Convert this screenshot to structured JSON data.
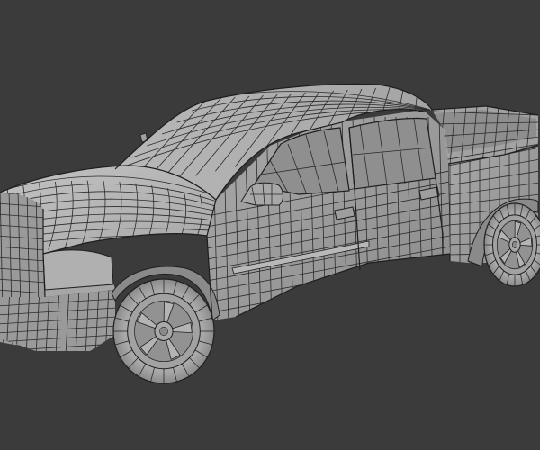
{
  "scene": {
    "subject": "pickup-truck-wireframe-model",
    "colors": {
      "background": "#3b3b3b",
      "body_light": "#b4b4b4",
      "body_mid": "#9c9c9c",
      "body_dark": "#808080",
      "window": "#8e8e8e",
      "tire": "#a6a6a6",
      "wire": "#2a2a2a"
    }
  }
}
